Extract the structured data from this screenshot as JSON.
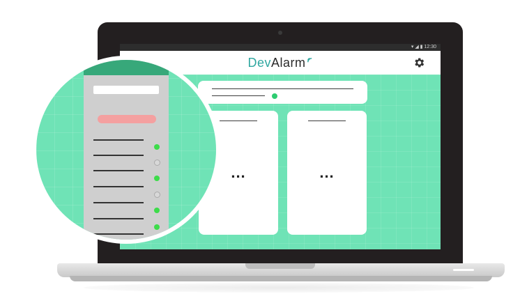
{
  "status_bar": {
    "time": "▾ ◢ ▮ 12:30"
  },
  "app": {
    "logo_prefix": "Dev",
    "logo_suffix": "Alarm"
  },
  "cards": [
    {
      "name": "card-a",
      "placeholder": "..."
    },
    {
      "name": "card-b",
      "placeholder": "..."
    }
  ],
  "magnified_list": {
    "rows": [
      {
        "state": "on"
      },
      {
        "state": "off"
      },
      {
        "state": "on"
      },
      {
        "state": "off"
      },
      {
        "state": "on"
      },
      {
        "state": "on"
      }
    ]
  },
  "colors": {
    "screen_bg": "#6fe3b6",
    "header_green": "#37a87a",
    "active_dot": "#3ddc4a",
    "button_pink": "#f4a0a0",
    "logo_dev": "#2fa7a0"
  },
  "icons": {
    "settings": "gear-icon",
    "logo_signal": "signal-icon"
  }
}
